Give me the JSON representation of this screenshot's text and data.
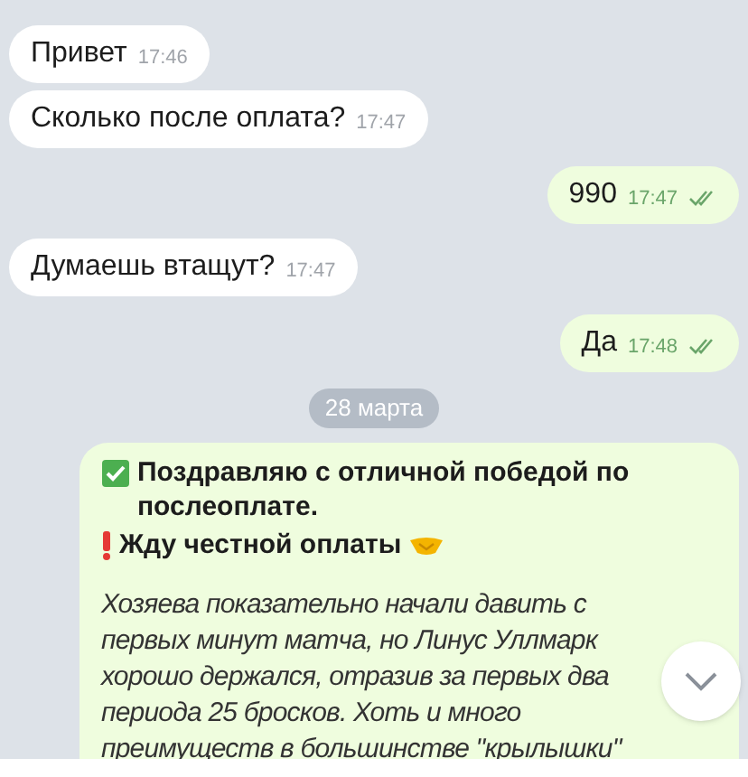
{
  "messages": [
    {
      "kind": "incoming",
      "text": "Привет",
      "time": "17:46"
    },
    {
      "kind": "incoming",
      "text": "Сколько после оплата?",
      "time": "17:47"
    },
    {
      "kind": "outgoing",
      "text": "990",
      "time": "17:47",
      "read": true
    },
    {
      "kind": "incoming",
      "text": "Думаешь втащут?",
      "time": "17:47"
    },
    {
      "kind": "outgoing",
      "text": "Да",
      "time": "17:48",
      "read": true
    },
    {
      "kind": "date",
      "text": "28 марта"
    },
    {
      "kind": "post",
      "headline": "Поздравляю с отличной победой по послеоплате.",
      "request": "Жду честной оплаты",
      "body": "Хозяева показательно начали давить с первых минут матча, но Линус Уллмарк хорошо держался, отразив за первых два периода 25 бросков. Хоть и много преимуществ в большинстве \"крылышки\""
    }
  ]
}
